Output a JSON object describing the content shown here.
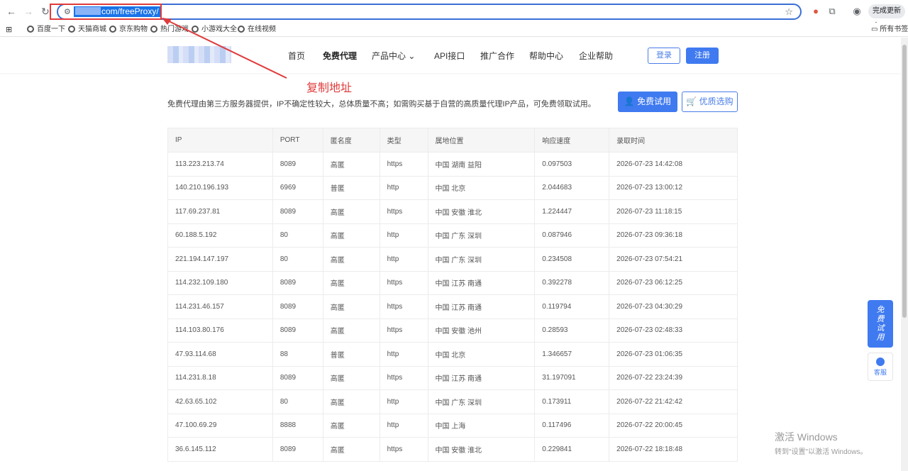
{
  "browser": {
    "url": "com/freeProxy/",
    "update_label": "完成更新",
    "bookmarks": [
      "百度一下",
      "天猫商城",
      "京东购物",
      "热门游戏",
      "小游戏大全",
      "在线视频"
    ],
    "all_bookmarks": "所有书签"
  },
  "annotation": {
    "label": "复制地址"
  },
  "header": {
    "nav": [
      "首页",
      "免费代理",
      "产品中心",
      "API接口",
      "推广合作",
      "帮助中心",
      "企业帮助"
    ],
    "login": "登录",
    "register": "注册"
  },
  "content": {
    "intro": "免费代理由第三方服务器提供，IP不确定性较大，总体质量不高；如需购买基于自营的高质量代理IP产品，可免费领取试用。",
    "trial_button": "免费试用",
    "quality_button": "优质选购"
  },
  "table": {
    "headers": [
      "IP",
      "PORT",
      "匿名度",
      "类型",
      "属地位置",
      "响应速度",
      "录取时间"
    ],
    "rows": [
      [
        "113.223.213.74",
        "8089",
        "高匿",
        "https",
        "中国 湖南 益阳",
        "0.097503",
        "2026-07-23 14:42:08"
      ],
      [
        "140.210.196.193",
        "6969",
        "普匿",
        "http",
        "中国 北京",
        "2.044683",
        "2026-07-23 13:00:12"
      ],
      [
        "117.69.237.81",
        "8089",
        "高匿",
        "https",
        "中国 安徽 淮北",
        "1.224447",
        "2026-07-23 11:18:15"
      ],
      [
        "60.188.5.192",
        "80",
        "高匿",
        "http",
        "中国 广东 深圳",
        "0.087946",
        "2026-07-23 09:36:18"
      ],
      [
        "221.194.147.197",
        "80",
        "高匿",
        "http",
        "中国 广东 深圳",
        "0.234508",
        "2026-07-23 07:54:21"
      ],
      [
        "114.232.109.180",
        "8089",
        "高匿",
        "https",
        "中国 江苏 南通",
        "0.392278",
        "2026-07-23 06:12:25"
      ],
      [
        "114.231.46.157",
        "8089",
        "高匿",
        "https",
        "中国 江苏 南通",
        "0.119794",
        "2026-07-23 04:30:29"
      ],
      [
        "114.103.80.176",
        "8089",
        "高匿",
        "https",
        "中国 安徽 池州",
        "0.28593",
        "2026-07-23 02:48:33"
      ],
      [
        "47.93.114.68",
        "88",
        "普匿",
        "http",
        "中国 北京",
        "1.346657",
        "2026-07-23 01:06:35"
      ],
      [
        "114.231.8.18",
        "8089",
        "高匿",
        "https",
        "中国 江苏 南通",
        "31.197091",
        "2026-07-22 23:24:39"
      ],
      [
        "42.63.65.102",
        "80",
        "高匿",
        "http",
        "中国 广东 深圳",
        "0.173911",
        "2026-07-22 21:42:42"
      ],
      [
        "47.100.69.29",
        "8888",
        "高匿",
        "http",
        "中国 上海",
        "0.117496",
        "2026-07-22 20:00:45"
      ],
      [
        "36.6.145.112",
        "8089",
        "高匿",
        "https",
        "中国 安徽 淮北",
        "0.229841",
        "2026-07-22 18:18:48"
      ]
    ]
  },
  "float": {
    "trial": "免费试用",
    "service": "客服"
  },
  "watermark": {
    "line1": "激活 Windows",
    "line2": "转到\"设置\"以激活 Windows。"
  },
  "colors": {
    "accent": "#3f7af0",
    "annotation": "#e03b3b"
  }
}
